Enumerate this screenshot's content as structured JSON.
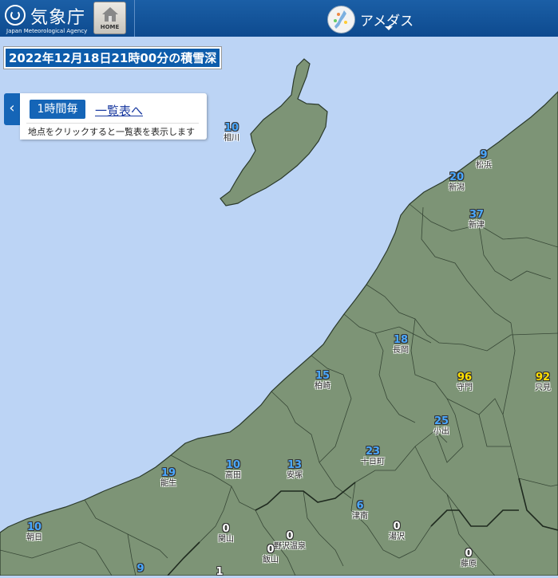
{
  "header": {
    "logo_jp": "気象庁",
    "logo_en": "Japan Meteorological Agency",
    "home_label": "HOME",
    "menu_label": "アメダス"
  },
  "map": {
    "title": "2022年12月18日21時00分の積雪深",
    "interval_button": "1時間毎",
    "list_link": "一覧表へ",
    "hint": "地点をクリックすると一覧表を表示します",
    "colors": {
      "sea": "#bcd4f5",
      "land": "#7d9476",
      "value_blue": "#4aa8ff",
      "value_yellow": "#ffe000",
      "value_white": "#ffffff"
    }
  },
  "stations": [
    {
      "name": "相川",
      "value": "10",
      "color": "#4aa8ff"
    },
    {
      "name": "松浜",
      "value": "9",
      "color": "#4aa8ff"
    },
    {
      "name": "新潟",
      "value": "20",
      "color": "#4aa8ff"
    },
    {
      "name": "新津",
      "value": "37",
      "color": "#4aa8ff"
    },
    {
      "name": "長岡",
      "value": "18",
      "color": "#4aa8ff"
    },
    {
      "name": "柏崎",
      "value": "15",
      "color": "#4aa8ff"
    },
    {
      "name": "守門",
      "value": "96",
      "color": "#ffe000"
    },
    {
      "name": "只見",
      "value": "92",
      "color": "#ffe000"
    },
    {
      "name": "小出",
      "value": "25",
      "color": "#4aa8ff"
    },
    {
      "name": "十日町",
      "value": "23",
      "color": "#4aa8ff"
    },
    {
      "name": "能生",
      "value": "19",
      "color": "#4aa8ff"
    },
    {
      "name": "高田",
      "value": "10",
      "color": "#4aa8ff"
    },
    {
      "name": "安塚",
      "value": "13",
      "color": "#4aa8ff"
    },
    {
      "name": "津南",
      "value": "6",
      "color": "#4aa8ff"
    },
    {
      "name": "朝日",
      "value": "10",
      "color": "#4aa8ff"
    },
    {
      "name": "関山",
      "value": "0",
      "color": "#ffffff"
    },
    {
      "name": "野沢温泉",
      "value": "0",
      "color": "#ffffff"
    },
    {
      "name": "湯沢",
      "value": "0",
      "color": "#ffffff"
    },
    {
      "name": "飯山",
      "value": "0",
      "color": "#ffffff"
    },
    {
      "name": "藤原",
      "value": "0",
      "color": "#ffffff"
    },
    {
      "name": "",
      "value": "9",
      "color": "#4aa8ff"
    },
    {
      "name": "",
      "value": "1",
      "color": "#ffffff"
    }
  ]
}
